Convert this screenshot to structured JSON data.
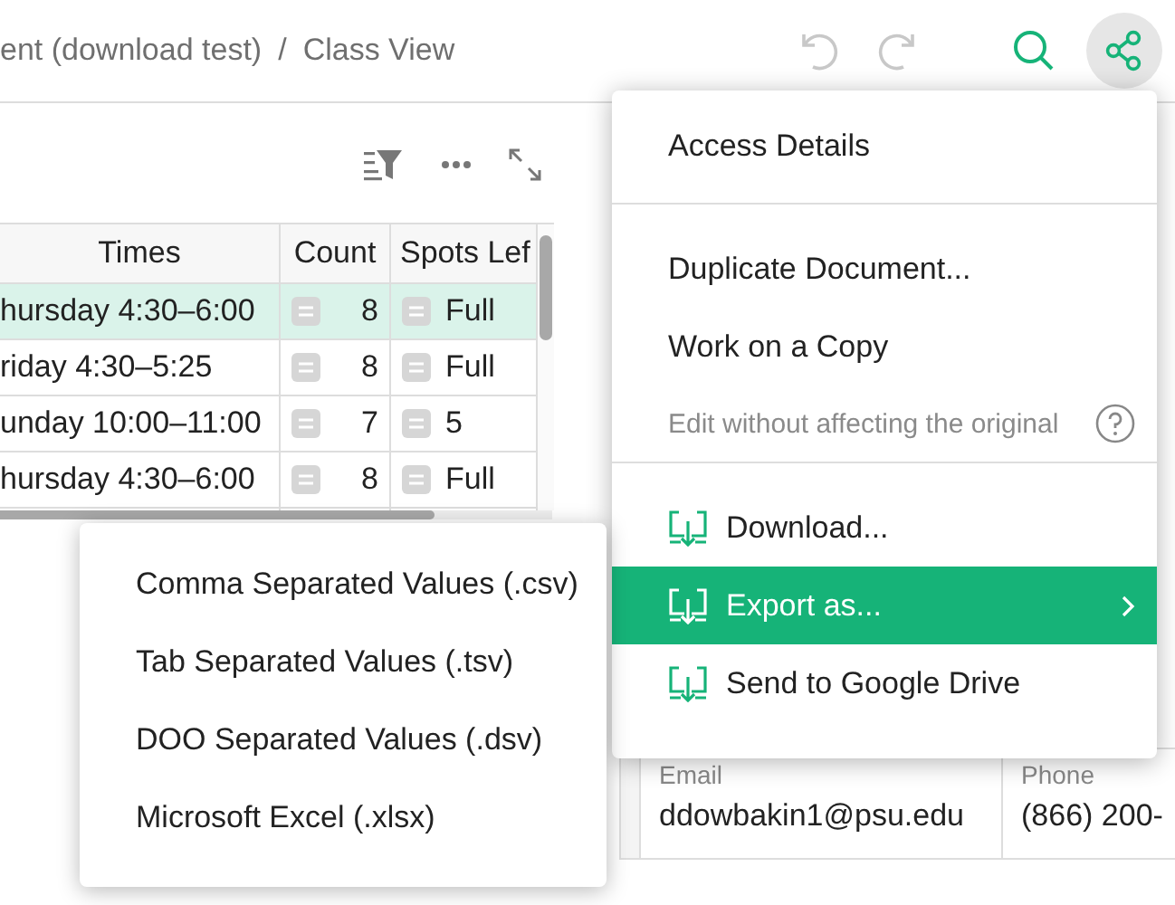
{
  "header": {
    "breadcrumb": [
      {
        "text": "ent (download test)"
      },
      {
        "text": "Class View"
      }
    ],
    "separator": "/",
    "undo": {
      "disabled": true
    },
    "redo": {
      "disabled": true
    },
    "share": {
      "active": true
    }
  },
  "table": {
    "columns": [
      "Times",
      "Count",
      "Spots Lef"
    ],
    "rows": [
      {
        "times": "hursday 4:30–6:00",
        "count": "8",
        "spots": "Full",
        "selected": true
      },
      {
        "times": "riday 4:30–5:25",
        "count": "8",
        "spots": "Full",
        "selected": false
      },
      {
        "times": "unday 10:00–11:00",
        "count": "7",
        "spots": "5",
        "selected": false
      },
      {
        "times": "hursday 4:30–6:00",
        "count": "8",
        "spots": "Full",
        "selected": false
      }
    ]
  },
  "record": {
    "fields": [
      {
        "label": "Email",
        "value": "ddowbakin1@psu.edu"
      },
      {
        "label": "Phone",
        "value": "(866) 200-"
      }
    ]
  },
  "share_menu": {
    "items": [
      {
        "kind": "item",
        "label": "Access Details",
        "selected": false
      },
      {
        "kind": "divider"
      },
      {
        "kind": "item",
        "label": "Duplicate Document...",
        "selected": false
      },
      {
        "kind": "item",
        "label": "Work on a Copy",
        "selected": false
      },
      {
        "kind": "hint",
        "label": "Edit without affecting the original"
      },
      {
        "kind": "divider"
      },
      {
        "kind": "export",
        "label": "Download...",
        "selected": false,
        "submenu": false
      },
      {
        "kind": "export",
        "label": "Export as...",
        "selected": true,
        "submenu": true
      },
      {
        "kind": "export",
        "label": "Send to Google Drive",
        "selected": false,
        "submenu": false
      }
    ]
  },
  "export_menu": {
    "items": [
      {
        "label": "Comma Separated Values (.csv)"
      },
      {
        "label": "Tab Separated Values (.tsv)"
      },
      {
        "label": "DOO Separated Values (.dsv)"
      },
      {
        "label": "Microsoft Excel (.xlsx)"
      }
    ]
  }
}
